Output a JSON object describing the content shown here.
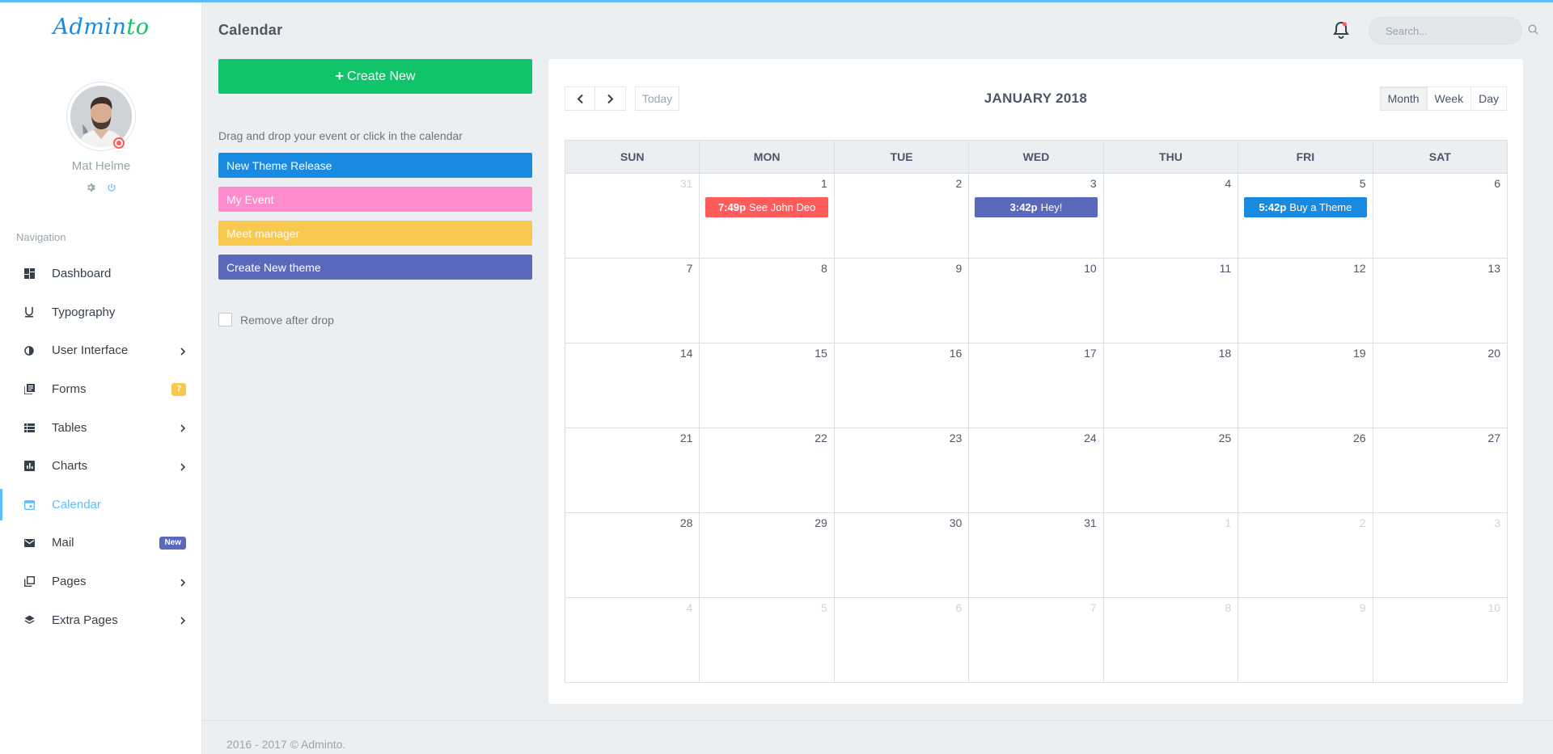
{
  "brand": {
    "logo_main": "Admin",
    "logo_accent": "to"
  },
  "user": {
    "name": "Mat Helme",
    "gear_icon": "gear-icon",
    "power_icon": "power-icon"
  },
  "navigation": {
    "title": "Navigation",
    "items": [
      {
        "label": "Dashboard",
        "icon": "dashboard-icon"
      },
      {
        "label": "Typography",
        "icon": "typography-icon"
      },
      {
        "label": "User Interface",
        "icon": "contrast-icon",
        "has_submenu": true
      },
      {
        "label": "Forms",
        "icon": "forms-icon",
        "badge": "7"
      },
      {
        "label": "Tables",
        "icon": "tables-icon",
        "has_submenu": true
      },
      {
        "label": "Charts",
        "icon": "charts-icon",
        "has_submenu": true
      },
      {
        "label": "Calendar",
        "icon": "calendar-icon",
        "active": true
      },
      {
        "label": "Mail",
        "icon": "mail-icon",
        "badge": "New"
      },
      {
        "label": "Pages",
        "icon": "pages-icon",
        "has_submenu": true
      },
      {
        "label": "Extra Pages",
        "icon": "layers-icon",
        "has_submenu": true
      }
    ]
  },
  "topbar": {
    "title": "Calendar",
    "search_placeholder": "Search..."
  },
  "events_panel": {
    "create_label": "Create New",
    "hint": "Drag and drop your event or click in the calendar",
    "events": [
      {
        "label": "New Theme Release",
        "color": "#188ae2"
      },
      {
        "label": "My Event",
        "color": "#ff8acc"
      },
      {
        "label": "Meet manager",
        "color": "#f9c851"
      },
      {
        "label": "Create New theme",
        "color": "#5b69bc"
      }
    ],
    "remove_after_drop": "Remove after drop"
  },
  "calendar": {
    "title": "JANUARY 2018",
    "today_label": "Today",
    "views": [
      "Month",
      "Week",
      "Day"
    ],
    "active_view": "Month",
    "weekdays": [
      "SUN",
      "MON",
      "TUE",
      "WED",
      "THU",
      "FRI",
      "SAT"
    ],
    "weeks": [
      [
        {
          "d": "31",
          "other": true
        },
        {
          "d": "1"
        },
        {
          "d": "2"
        },
        {
          "d": "3"
        },
        {
          "d": "4"
        },
        {
          "d": "5"
        },
        {
          "d": "6"
        }
      ],
      [
        {
          "d": "7"
        },
        {
          "d": "8"
        },
        {
          "d": "9"
        },
        {
          "d": "10"
        },
        {
          "d": "11"
        },
        {
          "d": "12"
        },
        {
          "d": "13"
        }
      ],
      [
        {
          "d": "14"
        },
        {
          "d": "15"
        },
        {
          "d": "16"
        },
        {
          "d": "17"
        },
        {
          "d": "18"
        },
        {
          "d": "19"
        },
        {
          "d": "20"
        }
      ],
      [
        {
          "d": "21"
        },
        {
          "d": "22"
        },
        {
          "d": "23"
        },
        {
          "d": "24"
        },
        {
          "d": "25"
        },
        {
          "d": "26"
        },
        {
          "d": "27"
        }
      ],
      [
        {
          "d": "28"
        },
        {
          "d": "29"
        },
        {
          "d": "30"
        },
        {
          "d": "31"
        },
        {
          "d": "1",
          "other": true
        },
        {
          "d": "2",
          "other": true
        },
        {
          "d": "3",
          "other": true
        }
      ],
      [
        {
          "d": "4",
          "other": true
        },
        {
          "d": "5",
          "other": true
        },
        {
          "d": "6",
          "other": true
        },
        {
          "d": "7",
          "other": true
        },
        {
          "d": "8",
          "other": true
        },
        {
          "d": "9",
          "other": true
        },
        {
          "d": "10",
          "other": true
        }
      ]
    ],
    "events": [
      {
        "week": 0,
        "day": 1,
        "time": "7:49p",
        "title": "See John Deo",
        "color": "#ff5b5b"
      },
      {
        "week": 0,
        "day": 3,
        "time": "3:42p",
        "title": "Hey!",
        "color": "#5b69bc"
      },
      {
        "week": 0,
        "day": 5,
        "time": "5:42p",
        "title": "Buy a Theme",
        "color": "#188ae2"
      }
    ]
  },
  "footer": {
    "text": "2016 - 2017 © Adminto."
  }
}
